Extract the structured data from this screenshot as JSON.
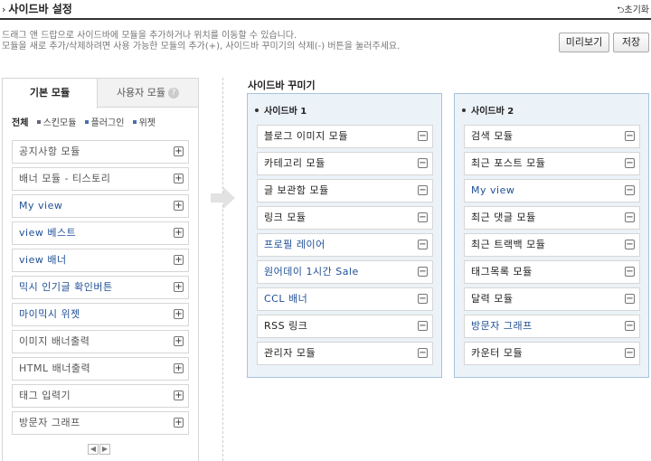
{
  "header": {
    "title_arrow": "›",
    "title": "사이드바 설정",
    "reset_arrow": "⮌",
    "reset": "초기화"
  },
  "description": {
    "line1": "드래그 앤 드랍으로 사이드바에 모듈을 추가하거나 위치를 이동할 수 있습니다.",
    "line2": "모듈을 새로 추가/삭제하려면 사용 가능한 모듈의 추가(+), 사이드바 꾸미기의 삭제(-) 버튼을 눌러주세요."
  },
  "buttons": {
    "preview": "미리보기",
    "save": "저장"
  },
  "left": {
    "tabs": {
      "basic": "기본 모듈",
      "user": "사용자 모듈",
      "help": "?"
    },
    "filters": [
      "전체",
      "스킨모듈",
      "플러그인",
      "위젯"
    ],
    "add_symbol": "+",
    "modules": [
      "공지사항 모듈",
      "배너 모듈 - 티스토리",
      "My view",
      "view 베스트",
      "view 배너",
      "믹시 인기글 확인버튼",
      "마이믹시 위젯",
      "이미지 배너출력",
      "HTML 배너출력",
      "태그 입력기",
      "방문자 그래프"
    ],
    "pager": {
      "prev": "◀",
      "next": "▶"
    }
  },
  "decorate": {
    "title": "사이드바 꾸미기",
    "remove_symbol": "−",
    "sidebar1": {
      "title": "사이드바 1",
      "modules": [
        "블로그 이미지 모듈",
        "카테고리 모듈",
        "글 보관함 모듈",
        "링크 모듈",
        "프로필 레이어",
        "원어데이 1시간 Sale",
        "CCL 배너",
        "RSS 링크",
        "관리자 모듈"
      ]
    },
    "sidebar2": {
      "title": "사이드바 2",
      "modules": [
        "검색 모듈",
        "최근 포스트 모듈",
        "My view",
        "최근 댓글 모듈",
        "최근 트랙백 모듈",
        "태그목록 모듈",
        "달력 모듈",
        "방문자 그래프",
        "카운터 모듈"
      ]
    }
  }
}
